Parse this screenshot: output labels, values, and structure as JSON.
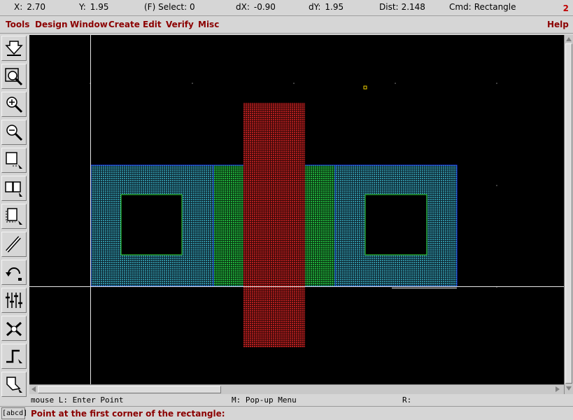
{
  "status": {
    "x_label": "X:",
    "x_value": "2.70",
    "y_label": "Y:",
    "y_value": "1.95",
    "select_text": "(F) Select: 0",
    "dx_label": "dX:",
    "dx_value": "-0.90",
    "dy_label": "dY:",
    "dy_value": "1.95",
    "dist_label": "Dist:",
    "dist_value": "2.148",
    "cmd_label": "Cmd:",
    "cmd_value": "Rectangle",
    "window_number": "2"
  },
  "menu": {
    "tools": "Tools",
    "design": "Design",
    "window": "Window",
    "create": "Create",
    "edit": "Edit",
    "verify": "Verify",
    "misc": "Misc",
    "help": "Help"
  },
  "toolbar": [
    {
      "icon": "save-icon"
    },
    {
      "icon": "zoom-fit-icon"
    },
    {
      "icon": "zoom-in-icon"
    },
    {
      "icon": "zoom-out-icon"
    },
    {
      "icon": "stretch-icon"
    },
    {
      "icon": "copy-icon"
    },
    {
      "icon": "move-icon"
    },
    {
      "icon": "path-icon"
    },
    {
      "icon": "undo-icon"
    },
    {
      "icon": "property-icon"
    },
    {
      "icon": "instance-icon"
    },
    {
      "icon": "wire-icon"
    },
    {
      "icon": "polygon-icon"
    }
  ],
  "layout_colors": {
    "diffusion": "#2f8fa0",
    "diffusion_edge": "#1e3cff",
    "gate_channel": "#1fae3c",
    "poly": "#b21e1e",
    "contact_edge": "#35e23a",
    "crosshair": "#e6e6e6",
    "marker": "#f0d000"
  },
  "mouse_hints": {
    "left": "mouse L: Enter Point",
    "middle": "M: Pop-up Menu",
    "right": "R:"
  },
  "prompt_box_label": "[abcd]",
  "prompt_text": "Point at the first corner of the rectangle:"
}
